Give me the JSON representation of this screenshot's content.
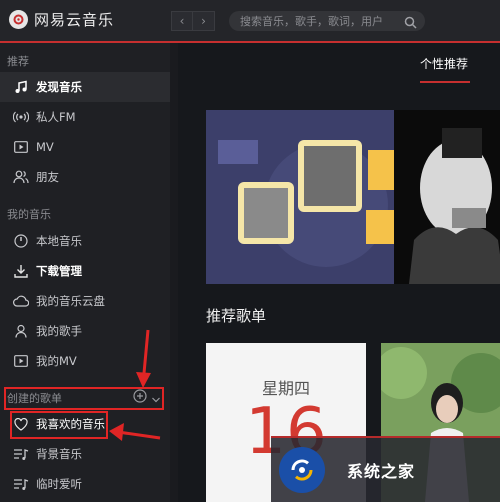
{
  "app": {
    "title": "网易云音乐"
  },
  "search": {
    "placeholder": "搜索音乐，歌手，歌词，用户"
  },
  "sidebar": {
    "sections": [
      {
        "title": "推荐",
        "items": [
          {
            "label": "发现音乐",
            "icon": "music-note-icon",
            "active": true
          },
          {
            "label": "私人FM",
            "icon": "radio-icon"
          },
          {
            "label": "MV",
            "icon": "play-icon"
          },
          {
            "label": "朋友",
            "icon": "friends-icon"
          }
        ]
      },
      {
        "title": "我的音乐",
        "items": [
          {
            "label": "本地音乐",
            "icon": "disc-icon"
          },
          {
            "label": "下载管理",
            "icon": "download-icon"
          },
          {
            "label": "我的音乐云盘",
            "icon": "cloud-icon"
          },
          {
            "label": "我的歌手",
            "icon": "person-icon"
          },
          {
            "label": "我的MV",
            "icon": "play-icon"
          }
        ]
      },
      {
        "title": "创建的歌单",
        "items": [
          {
            "label": "我喜欢的音乐",
            "icon": "heart-icon"
          },
          {
            "label": "背景音乐",
            "icon": "playlist-icon"
          },
          {
            "label": "临时爱听",
            "icon": "playlist-icon"
          }
        ]
      }
    ]
  },
  "main": {
    "tab": "个性推荐",
    "section_title": "推荐歌单",
    "card": {
      "weekday": "星期四",
      "day": "16"
    }
  },
  "watermark": {
    "text": "系统之家"
  },
  "colors": {
    "accent": "#c62f2f",
    "annotation": "#e02525"
  }
}
